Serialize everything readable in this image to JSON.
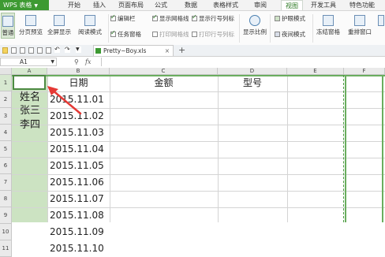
{
  "app": {
    "name": "WPS 表格"
  },
  "menu_tabs": [
    "开始",
    "插入",
    "页面布局",
    "公式",
    "数据",
    "表格样式",
    "审阅",
    "视图",
    "开发工具",
    "特色功能"
  ],
  "active_tab": "视图",
  "ribbon": {
    "buttons": {
      "normal": "普通",
      "page_break": "分页预览",
      "full_screen": "全屏显示",
      "reading_mode": "阅读模式",
      "show_ratio": "显示比例",
      "freeze": "冻结窗格",
      "rearrange": "重排窗口"
    },
    "checks": {
      "edit_bar": "编辑栏",
      "show_gridlines": "显示网格线",
      "show_row_col_headers": "显示行号列标",
      "task_pane": "任务窗格",
      "print_gridlines": "打印网格线",
      "print_row_col_headers": "打印行号列标",
      "eye_protect": "护眼模式",
      "night_mode": "夜间模式"
    }
  },
  "document": {
    "tab_name": "Pretty~Boy.xls",
    "close": "×",
    "add": "+"
  },
  "formula_bar": {
    "cell_ref": "A1",
    "fx": "fx",
    "zoom_icon": "magnifier-icon"
  },
  "sheet": {
    "columns": [
      "A",
      "B",
      "C",
      "D",
      "E",
      "F"
    ],
    "rows": [
      "1",
      "2",
      "3",
      "4",
      "5",
      "6",
      "7",
      "8",
      "9",
      "10",
      "11"
    ],
    "headers": {
      "B1": "日期",
      "C1": "金额",
      "D1": "型号"
    },
    "colA": [
      "姓名",
      "张三",
      "李四"
    ],
    "dates": [
      "2015.11.01",
      "2015.11.02",
      "2015.11.03",
      "2015.11.04",
      "2015.11.05",
      "2015.11.06",
      "2015.11.07",
      "2015.11.08",
      "2015.11.09",
      "2015.11.10"
    ],
    "selected_cell": "A1"
  },
  "colors": {
    "accent": "#3d9a32",
    "selection": "#cce3c2",
    "arrow": "#e53935"
  }
}
